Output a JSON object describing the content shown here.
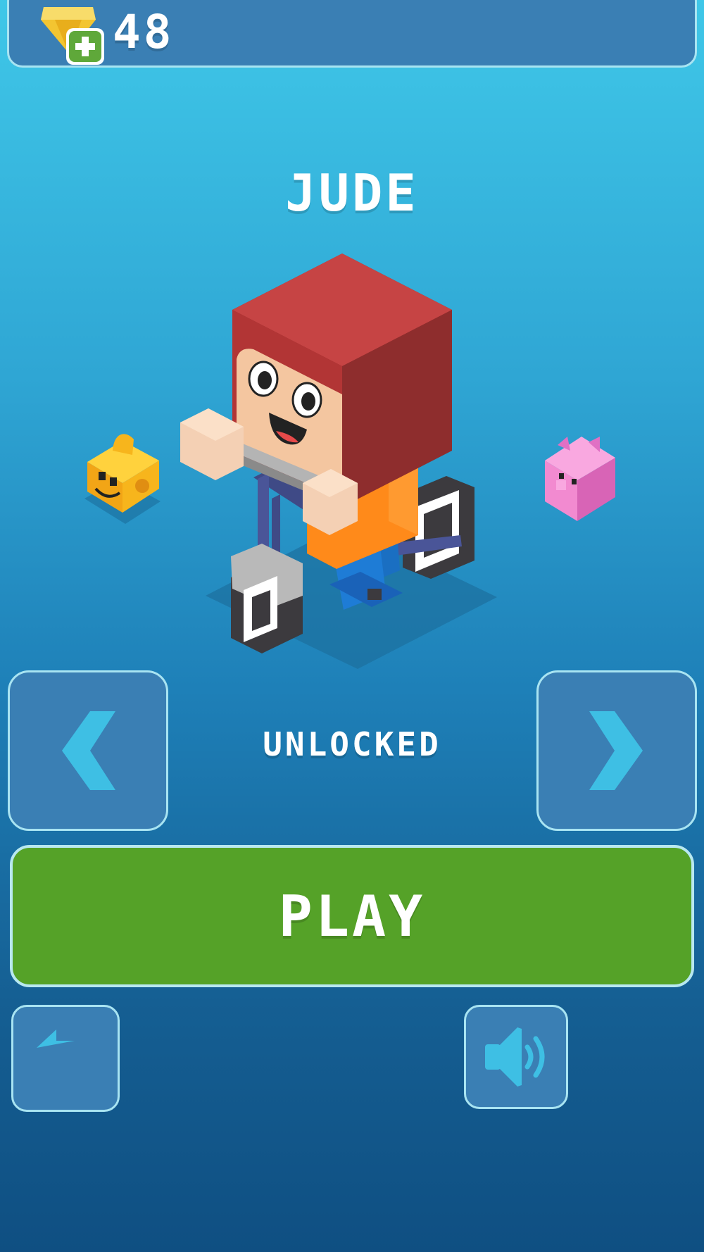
{
  "header": {
    "coins": "48",
    "gem_icon": "gem-plus-icon"
  },
  "character": {
    "name": "JUDE",
    "status": "UNLOCKED",
    "current": "boy-on-bicycle",
    "prev_preview": "cheese-cube-character",
    "next_preview": "pink-pig-character"
  },
  "controls": {
    "prev_icon": "chevron-left-icon",
    "next_icon": "chevron-right-icon",
    "play_label": "PLAY",
    "back_icon": "back-arrow-icon",
    "sound_icon": "speaker-icon"
  },
  "colors": {
    "play_button": "#55a228",
    "panel": "#3a7fb4",
    "panel_border": "#a8e4f2",
    "arrow": "#3ebfe4"
  }
}
